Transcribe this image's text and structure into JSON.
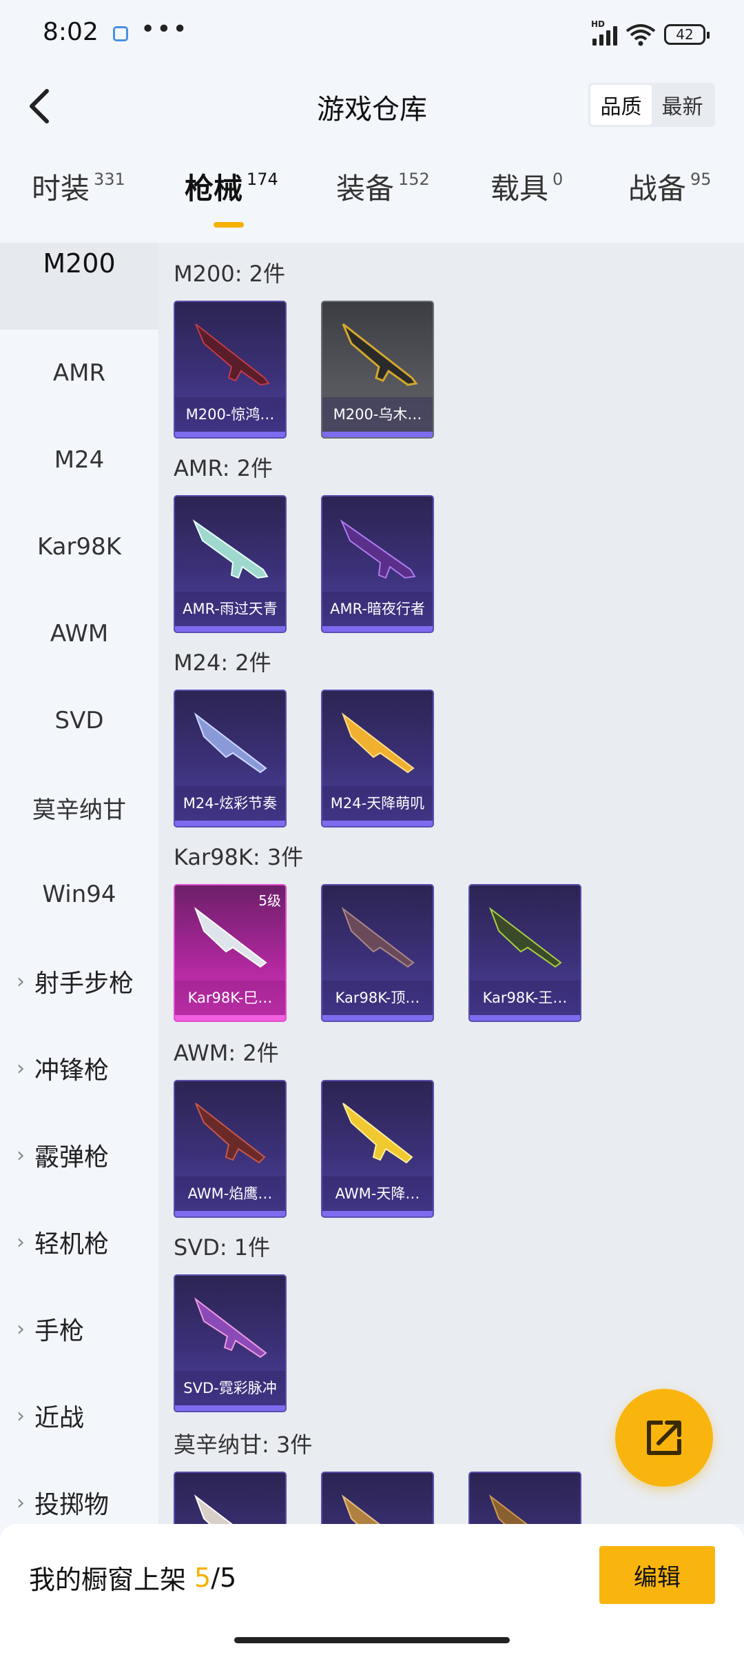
{
  "status": {
    "time": "8:02",
    "battery": "42",
    "more": "•••",
    "network_label": "HD"
  },
  "header": {
    "title": "游戏仓库",
    "sort_options": [
      "品质",
      "最新"
    ],
    "back_icon": "chevron-left-icon"
  },
  "tabs": [
    {
      "label": "时装",
      "count": "331"
    },
    {
      "label": "枪械",
      "count": "174"
    },
    {
      "label": "装备",
      "count": "152"
    },
    {
      "label": "载具",
      "count": "0"
    },
    {
      "label": "战备",
      "count": "95"
    }
  ],
  "sidebar": {
    "items": [
      "M200",
      "AMR",
      "M24",
      "Kar98K",
      "AWM",
      "SVD",
      "莫辛纳甘",
      "Win94"
    ],
    "categories": [
      "射手步枪",
      "冲锋枪",
      "霰弹枪",
      "轻机枪",
      "手枪",
      "近战",
      "投掷物"
    ]
  },
  "sections": [
    {
      "title": "M200: 2件",
      "cards": [
        {
          "name": "M200-惊鸿…"
        },
        {
          "name": "M200-乌木…"
        }
      ]
    },
    {
      "title": "AMR: 2件",
      "cards": [
        {
          "name": "AMR-雨过天青"
        },
        {
          "name": "AMR-暗夜行者"
        }
      ]
    },
    {
      "title": "M24: 2件",
      "cards": [
        {
          "name": "M24-炫彩节奏"
        },
        {
          "name": "M24-天降萌叽"
        }
      ]
    },
    {
      "title": "Kar98K: 3件",
      "cards": [
        {
          "name": "Kar98K-巳…",
          "level": "5级"
        },
        {
          "name": "Kar98K-顶…"
        },
        {
          "name": "Kar98K-王…"
        }
      ]
    },
    {
      "title": "AWM: 2件",
      "cards": [
        {
          "name": "AWM-焰鹰…"
        },
        {
          "name": "AWM-天降…"
        }
      ]
    },
    {
      "title": "SVD: 1件",
      "cards": [
        {
          "name": "SVD-霓彩脉冲"
        }
      ]
    },
    {
      "title": "莫辛纳甘: 3件",
      "cards": []
    }
  ],
  "bottom": {
    "shelf_label": "我的橱窗上架",
    "shelf_current": "5",
    "shelf_total": "/5",
    "edit_label": "编辑"
  },
  "colors": {
    "accent": "#f9b50e",
    "card_purple": "#3c3179",
    "card_pink": "#d93bc1",
    "card_grey": "#55575d"
  }
}
